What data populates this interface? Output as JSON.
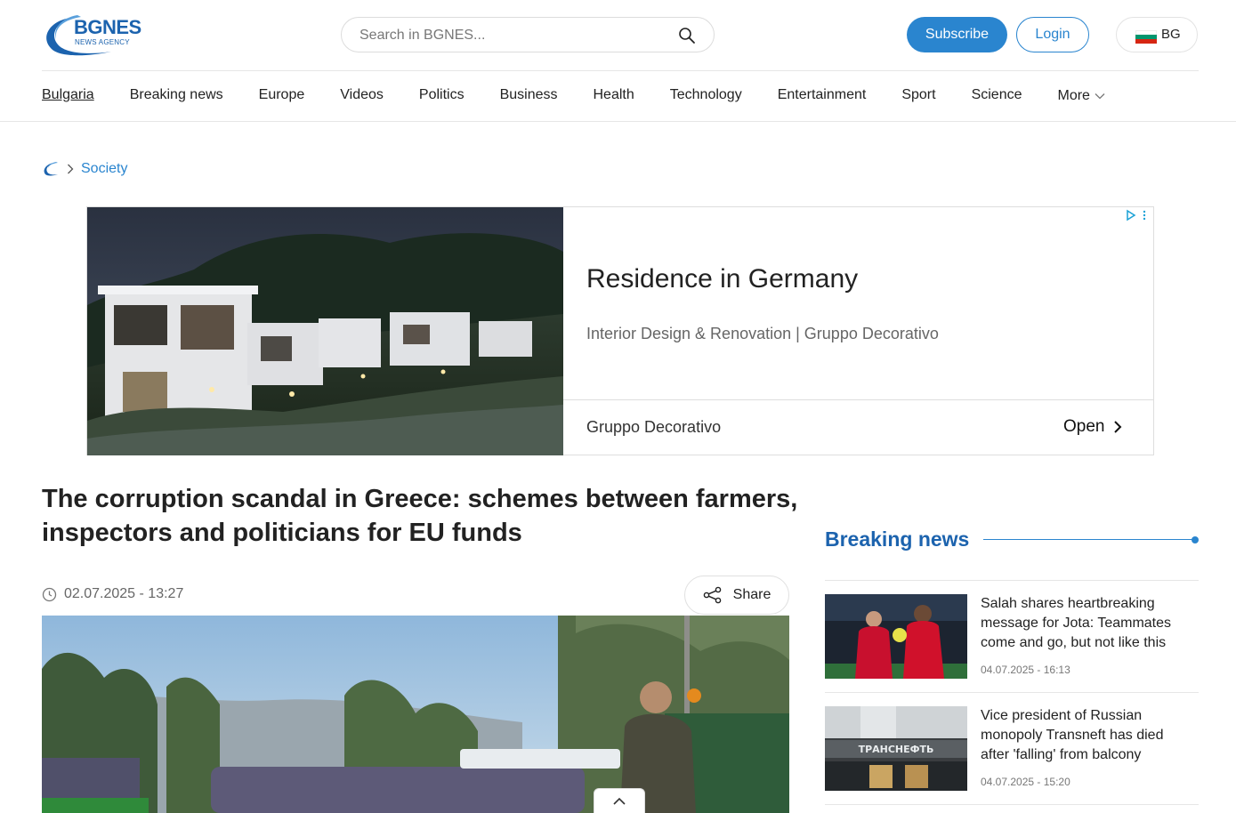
{
  "brand": {
    "name": "BGNES",
    "tagline": "NEWS AGENCY",
    "color": "#1c63ae"
  },
  "search": {
    "placeholder": "Search in BGNES..."
  },
  "header": {
    "subscribe_label": "Subscribe",
    "login_label": "Login",
    "language_label": "BG",
    "accent_color": "#2a85cf"
  },
  "nav": {
    "items": [
      {
        "label": "Bulgaria",
        "active": true
      },
      {
        "label": "Breaking news"
      },
      {
        "label": "Europe"
      },
      {
        "label": "Videos"
      },
      {
        "label": "Politics"
      },
      {
        "label": "Business"
      },
      {
        "label": "Health"
      },
      {
        "label": "Technology"
      },
      {
        "label": "Entertainment"
      },
      {
        "label": "Sport"
      },
      {
        "label": "Science"
      },
      {
        "label": "More"
      }
    ]
  },
  "breadcrumb": {
    "current": "Society"
  },
  "ad": {
    "title": "Residence in Germany",
    "subtitle": "Interior Design & Renovation | Gruppo Decorativo",
    "advertiser": "Gruppo Decorativo",
    "cta": "Open"
  },
  "article": {
    "title": "The corruption scandal in Greece: schemes between farmers, inspectors and politicians for EU funds",
    "datetime": "02.07.2025 - 13:27",
    "share_label": "Share"
  },
  "sidebar": {
    "title": "Breaking news",
    "items": [
      {
        "title": "Salah shares heartbreaking message for Jota: Teammates come and go, but not like this",
        "time": "04.07.2025 - 16:13"
      },
      {
        "title": "Vice president of Russian monopoly Transneft has died after 'falling' from balcony",
        "time": "04.07.2025 - 15:20"
      }
    ]
  },
  "image_text": {
    "transneft_sign": "ТРАНСНЕФТЬ"
  }
}
